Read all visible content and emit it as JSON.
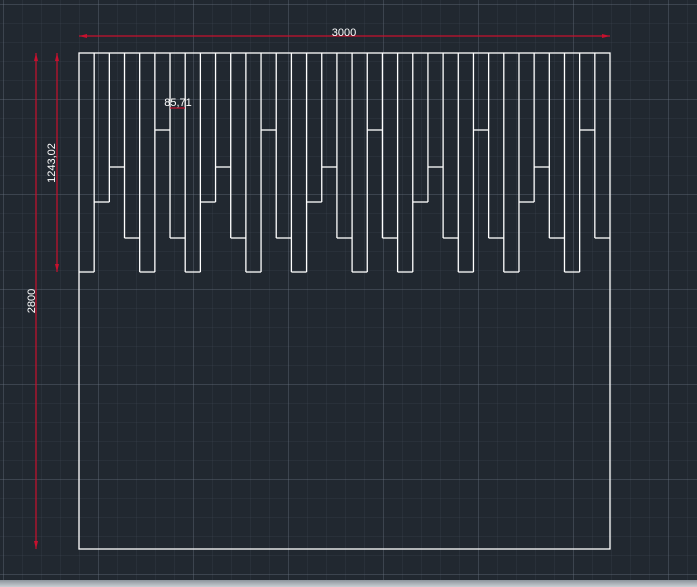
{
  "drawing": {
    "dimensions": {
      "overall_width": "3000",
      "overall_height": "2800",
      "fringe_depth": "1243,02",
      "strip_width": "85,71"
    },
    "colors": {
      "background": "#212830",
      "geometry": "#ffffff",
      "dimension_line": "#c8102e",
      "dimension_text": "#ffffff"
    }
  }
}
